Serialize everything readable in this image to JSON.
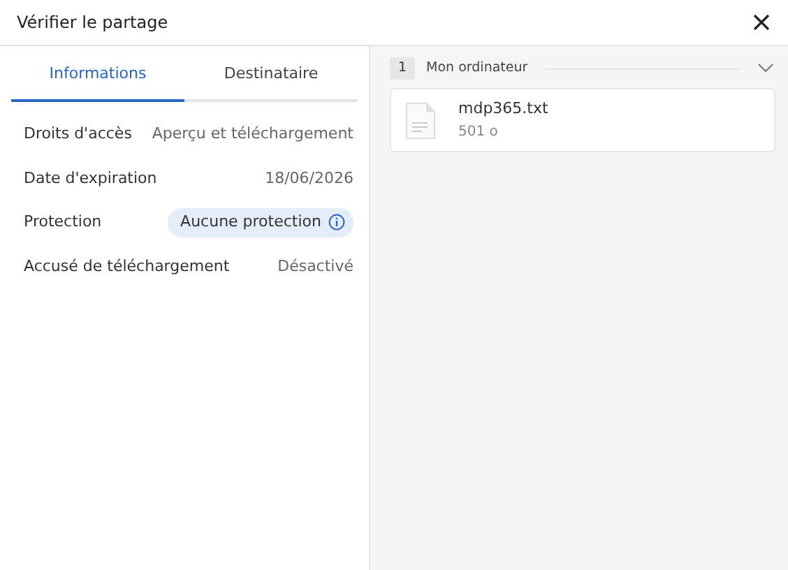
{
  "window": {
    "title": "Vérifier le partage"
  },
  "tabs": [
    {
      "label": "Informations",
      "selected": true
    },
    {
      "label": "Destinataire",
      "selected": false
    }
  ],
  "properties": [
    {
      "label": "Droits d'accès",
      "value": "Aperçu et téléchargement",
      "kind": "text"
    },
    {
      "label": "Date d'expiration",
      "value": "18/06/2026",
      "kind": "text"
    },
    {
      "label": "Protection",
      "value": "Aucune protection",
      "kind": "pill"
    },
    {
      "label": "Accusé de téléchargement",
      "value": "Désactivé",
      "kind": "text"
    }
  ],
  "source_group": {
    "count": "1",
    "name": "Mon ordinateur",
    "expanded": true,
    "files": [
      {
        "name": "mdp365.txt",
        "size": "501 o"
      }
    ]
  }
}
